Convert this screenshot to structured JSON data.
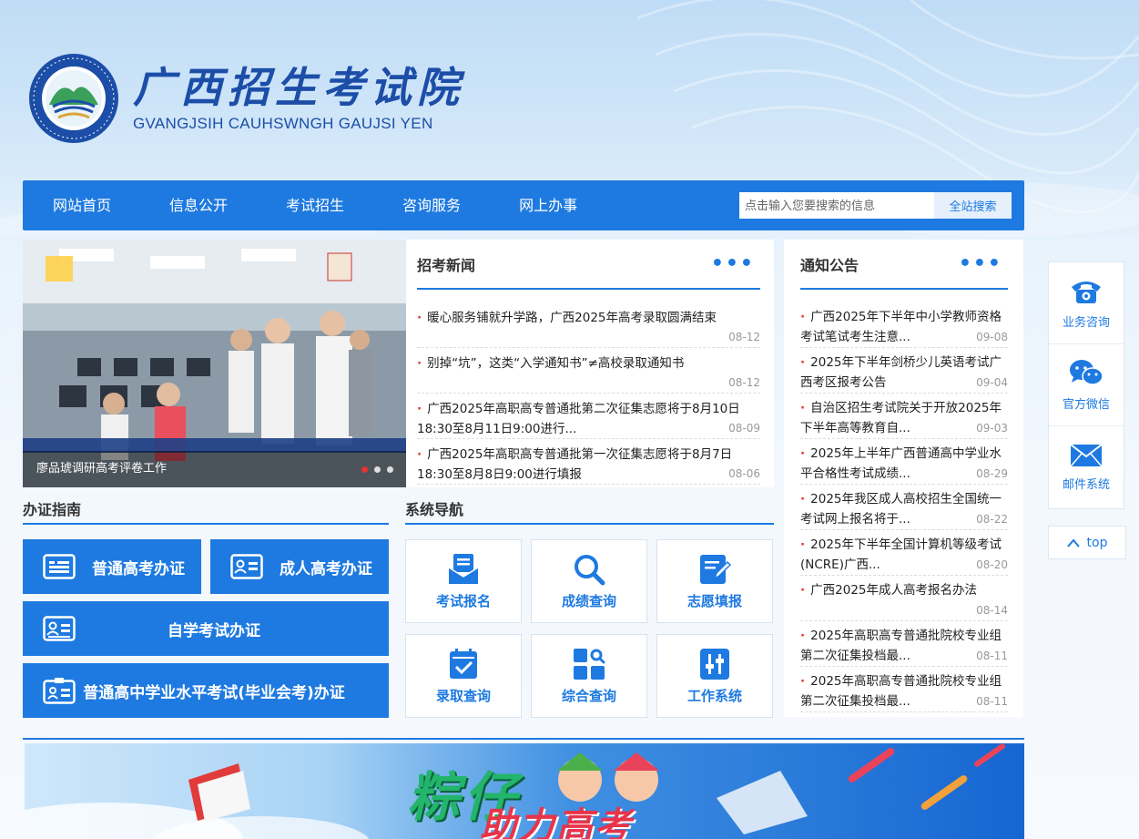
{
  "site": {
    "title_cn": "广西招生考试院",
    "title_en": "GVANGJSIH CAUHSWNGH GAUJSI YEN"
  },
  "nav": {
    "items": [
      "网站首页",
      "信息公开",
      "考试招生",
      "咨询服务",
      "网上办事"
    ],
    "search_placeholder": "点击输入您要搜索的信息",
    "search_button": "全站搜索"
  },
  "carousel": {
    "caption": "廖品琥调研高考评卷工作",
    "slide_count": 3,
    "active_index": 0
  },
  "news": {
    "title": "招考新闻",
    "items": [
      {
        "title": "暖心服务铺就升学路，广西2025年高考录取圆满结束",
        "date": "08-12"
      },
      {
        "title": "别掉“坑”，这类“入学通知书”≠高校录取通知书",
        "date": "08-12"
      },
      {
        "title": "广西2025年高职高专普通批第二次征集志愿将于8月10日18:30至8月11日9:00进行...",
        "date": "08-09"
      },
      {
        "title": "广西2025年高职高专普通批第一次征集志愿将于8月7日18:30至8月8日9:00进行填报",
        "date": "08-06"
      }
    ]
  },
  "notices": {
    "title": "通知公告",
    "items": [
      {
        "title": "广西2025年下半年中小学教师资格考试笔试考生注意...",
        "date": "09-08"
      },
      {
        "title": "2025年下半年剑桥少儿英语考试广西考区报考公告",
        "date": "09-04"
      },
      {
        "title": "自治区招生考试院关于开放2025年下半年高等教育自...",
        "date": "09-03"
      },
      {
        "title": "2025年上半年广西普通高中学业水平合格性考试成绩...",
        "date": "08-29"
      },
      {
        "title": "2025年我区成人高校招生全国统一考试网上报名将于...",
        "date": "08-22"
      },
      {
        "title": "2025年下半年全国计算机等级考试(NCRE)广西...",
        "date": "08-20"
      },
      {
        "title": "广西2025年成人高考报名办法",
        "date": "08-14"
      },
      {
        "title": "2025年高职高专普通批院校专业组第二次征集投档最...",
        "date": "08-11"
      },
      {
        "title": "2025年高职高专普通批院校专业组第二次征集投档最...",
        "date": "08-11"
      }
    ]
  },
  "more_symbol": "•••",
  "guide": {
    "title": "办证指南",
    "buttons": [
      "普通高考办证",
      "成人高考办证",
      "自学考试办证",
      "普通高中学业水平考试(毕业会考)办证"
    ]
  },
  "system_nav": {
    "title": "系统导航",
    "tiles": [
      "考试报名",
      "成绩查询",
      "志愿填报",
      "录取查询",
      "综合查询",
      "工作系统"
    ]
  },
  "sidebar": {
    "items": [
      "业务咨询",
      "官方微信",
      "邮件系统"
    ],
    "top_label": "top"
  },
  "banner": {
    "text_main": "粽仔",
    "text_sub": "助力高考"
  },
  "colors": {
    "primary": "#1e7ae0",
    "accent_red": "#e83232",
    "title_blue": "#1c4ea8"
  }
}
